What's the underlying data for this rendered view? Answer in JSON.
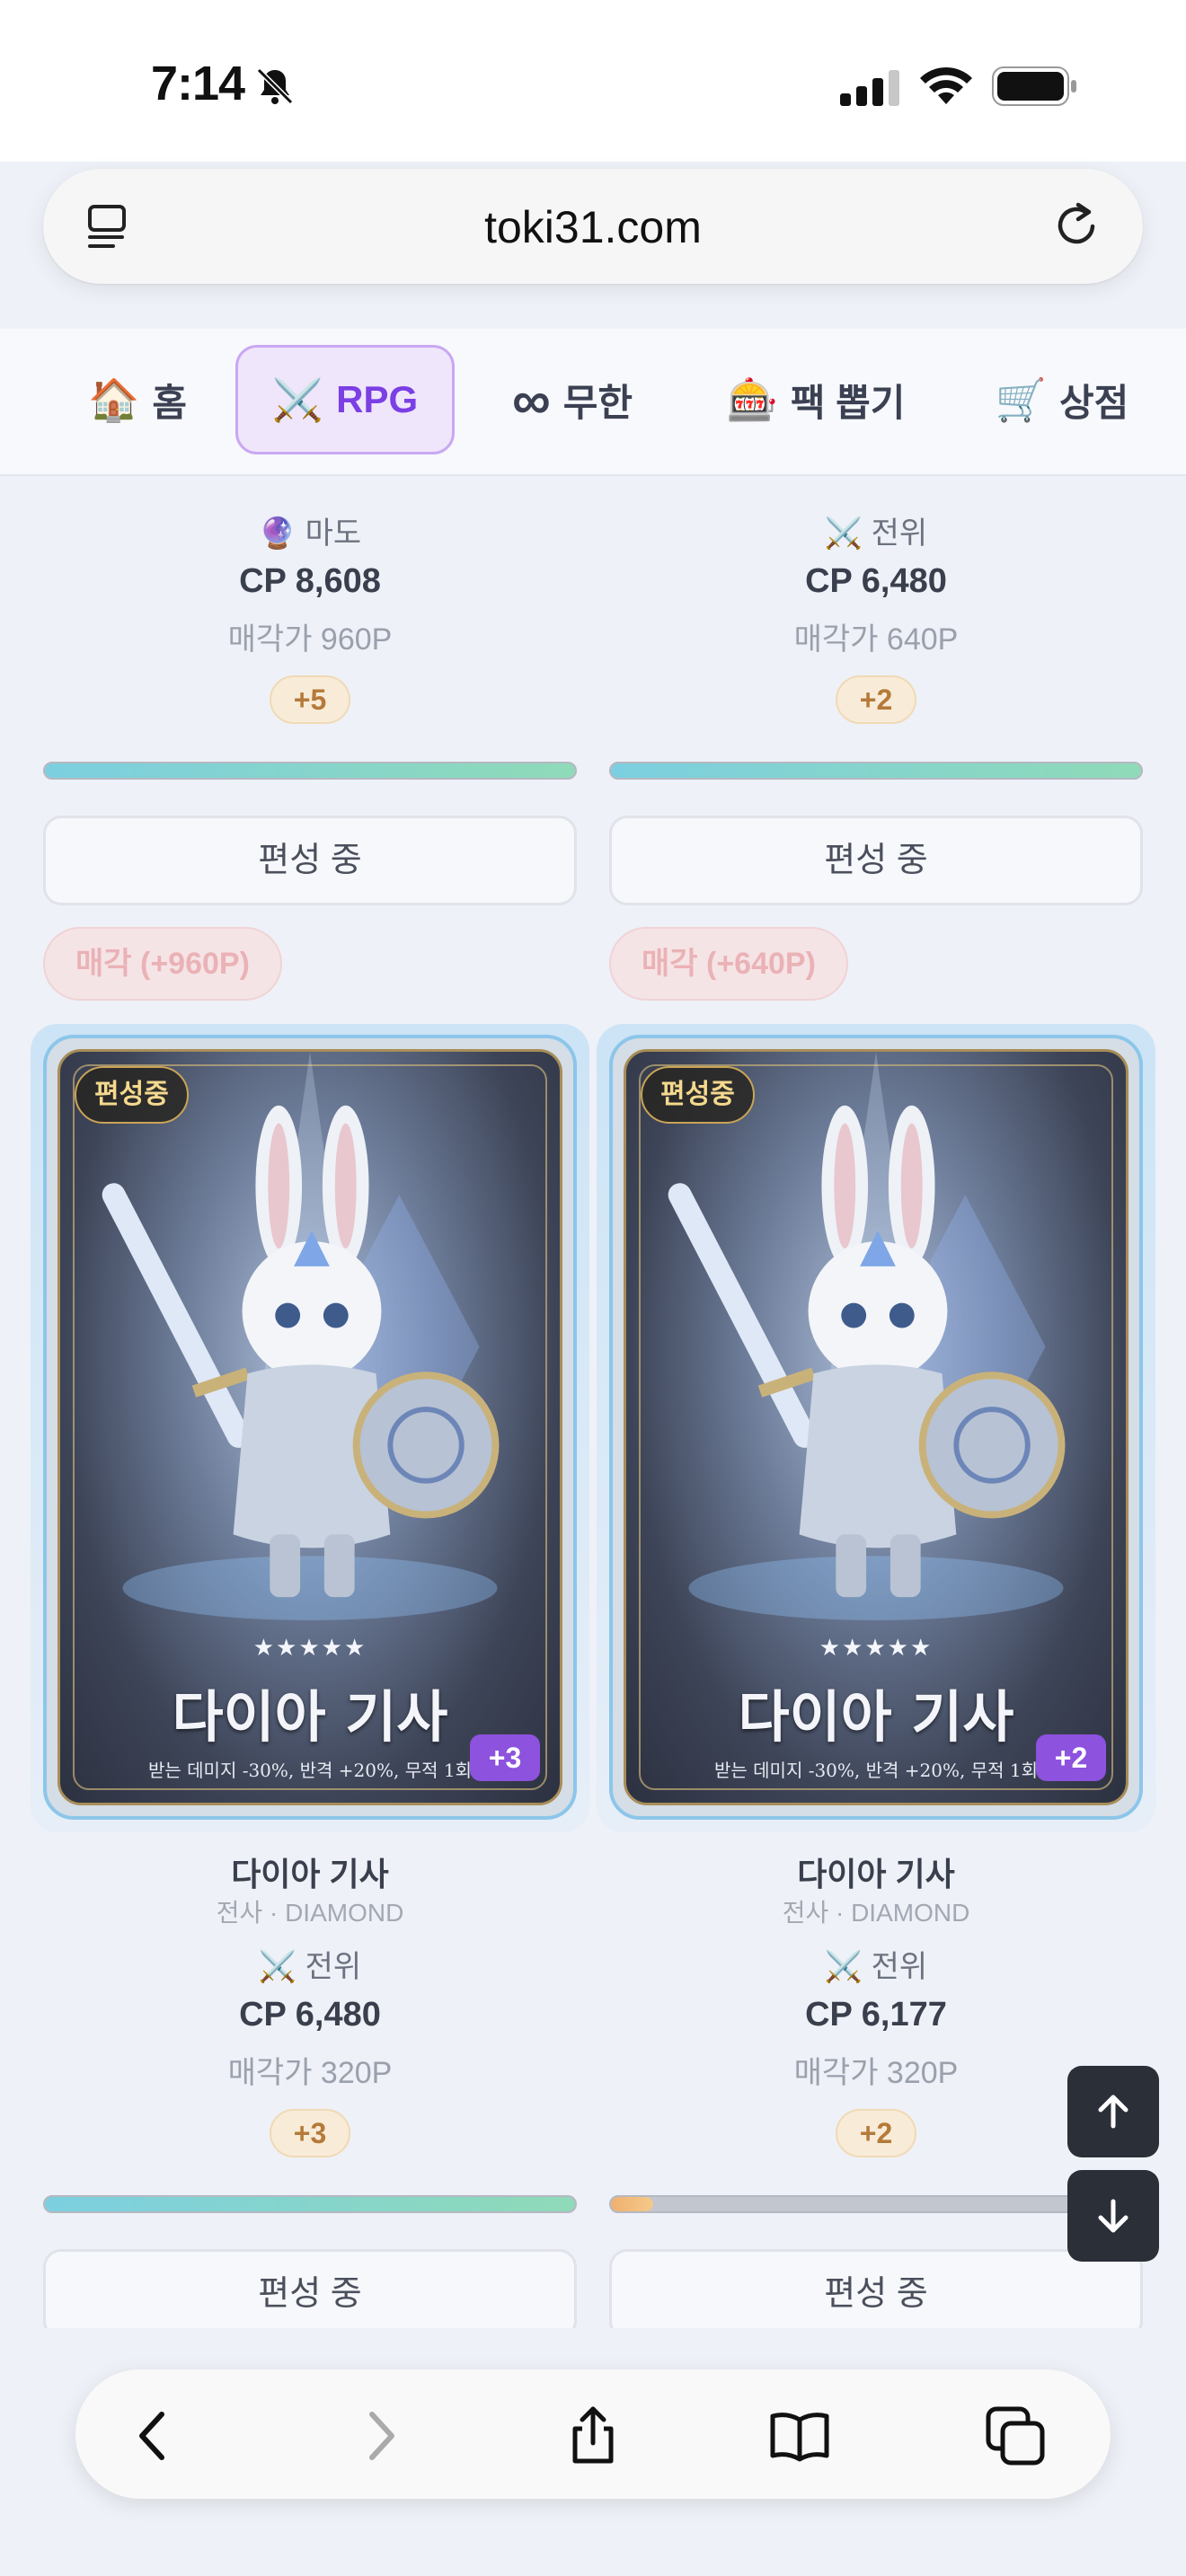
{
  "status": {
    "time": "7:14"
  },
  "browser": {
    "url": "toki31.com"
  },
  "nav": {
    "tabs": [
      {
        "icon": "🏠",
        "label": "홈"
      },
      {
        "icon": "⚔️",
        "label": "RPG"
      },
      {
        "icon": "∞",
        "label": "무한"
      },
      {
        "icon": "🎰",
        "label": "팩 뽑기"
      },
      {
        "icon": "🛒",
        "label": "상점"
      }
    ]
  },
  "cards_top": [
    {
      "role_icon": "🔮",
      "role": "마도",
      "cp": "CP 8,608",
      "price": "매각가 960P",
      "level": "+5",
      "bar_fill": 1.0,
      "button": "편성 중",
      "sell": "매각 (+960P)"
    },
    {
      "role_icon": "⚔️",
      "role": "전위",
      "cp": "CP 6,480",
      "price": "매각가 640P",
      "level": "+2",
      "bar_fill": 1.0,
      "button": "편성 중",
      "sell": "매각 (+640P)"
    }
  ],
  "cards_bottom": [
    {
      "badge": "편성중",
      "stars": "★★★★★",
      "card_title": "다이아 기사",
      "card_desc": "받는 데미지 -30%, 반격 +20%, 무적 1회",
      "chip": "+3",
      "name": "다이아 기사",
      "class": "전사 · DIAMOND",
      "role_icon": "⚔️",
      "role": "전위",
      "cp": "CP 6,480",
      "price": "매각가 320P",
      "level": "+3",
      "bar_fill": 1.0,
      "button": "편성 중"
    },
    {
      "badge": "편성중",
      "stars": "★★★★★",
      "card_title": "다이아 기사",
      "card_desc": "받는 데미지 -30%, 반격 +20%, 무적 1회",
      "chip": "+2",
      "name": "다이아 기사",
      "class": "전사 · DIAMOND",
      "role_icon": "⚔️",
      "role": "전위",
      "cp": "CP 6,177",
      "price": "매각가 320P",
      "level": "+2",
      "bar_fill": 0.08,
      "button": "편성 중"
    }
  ],
  "colors": {
    "accent": "#7b3fe4",
    "chip": "#8d52de",
    "bar": "#7ccfe0"
  }
}
